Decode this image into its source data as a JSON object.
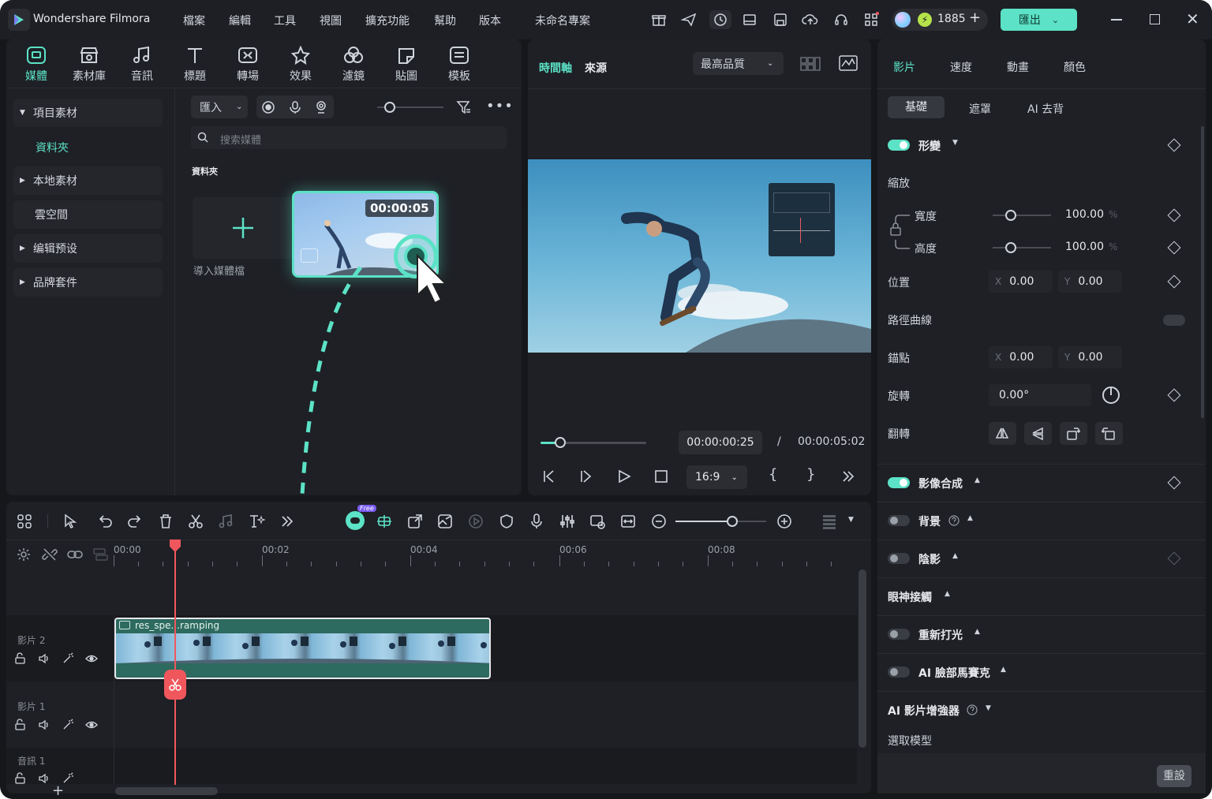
{
  "app": {
    "name": "Wondershare Filmora",
    "project": "未命名專案"
  },
  "menu": [
    "檔案",
    "編輯",
    "工具",
    "視圖",
    "擴充功能",
    "幫助",
    "版本"
  ],
  "credits": "1885",
  "export_label": "匯出",
  "media_tools": [
    "媒體",
    "素材庫",
    "音訊",
    "標題",
    "轉場",
    "效果",
    "濾鏡",
    "貼圖",
    "模板"
  ],
  "sidebar": [
    "項目素材",
    "資料夾",
    "本地素材",
    "雲空間",
    "编辑预设",
    "品牌套件"
  ],
  "media": {
    "import_label": "匯入",
    "search_placeholder": "搜索媒體",
    "folder_label": "資料夾",
    "import_media_label": "導入媒體檔",
    "clip_duration": "00:00:05"
  },
  "preview": {
    "tabs": [
      "時間軸",
      "來源"
    ],
    "quality": "最高品質",
    "current_time": "00:00:00:25",
    "separator": "/",
    "total_time": "00:00:05:02",
    "ratio": "16:9",
    "progress": 0.19
  },
  "props": {
    "tabs": [
      "影片",
      "速度",
      "動畫",
      "顏色"
    ],
    "subtabs": [
      "基礎",
      "遮罩",
      "AI 去背"
    ],
    "transform_title": "形變",
    "scale_label": "縮放",
    "width_label": "寬度",
    "height_label": "高度",
    "width_value": "100.00",
    "height_value": "100.00",
    "unit": "%",
    "position_label": "位置",
    "pos_x": "0.00",
    "pos_y": "0.00",
    "path_label": "路徑曲線",
    "anchor_label": "錨點",
    "anchor_x": "0.00",
    "anchor_y": "0.00",
    "rotate_label": "旋轉",
    "rotate_value": "0.00°",
    "flip_label": "翻轉",
    "x_axis": "X",
    "y_axis": "Y",
    "sections": [
      "影像合成",
      "背景",
      "陰影",
      "眼神接觸",
      "重新打光",
      "AI 臉部馬賽克",
      "AI 影片增強器"
    ],
    "model_label": "選取模型",
    "reset_label": "重設"
  },
  "timeline": {
    "free_badge": "Free",
    "ruler": [
      "00:00",
      "00:02",
      "00:04",
      "00:06",
      "00:08"
    ],
    "tracks": [
      "影片 2",
      "影片 1",
      "音訊 1"
    ],
    "clip_name": "res_spe...ramping"
  },
  "colors": {
    "accent": "#5ce2c6",
    "playhead": "#f0575d",
    "bg": "#16171b"
  }
}
